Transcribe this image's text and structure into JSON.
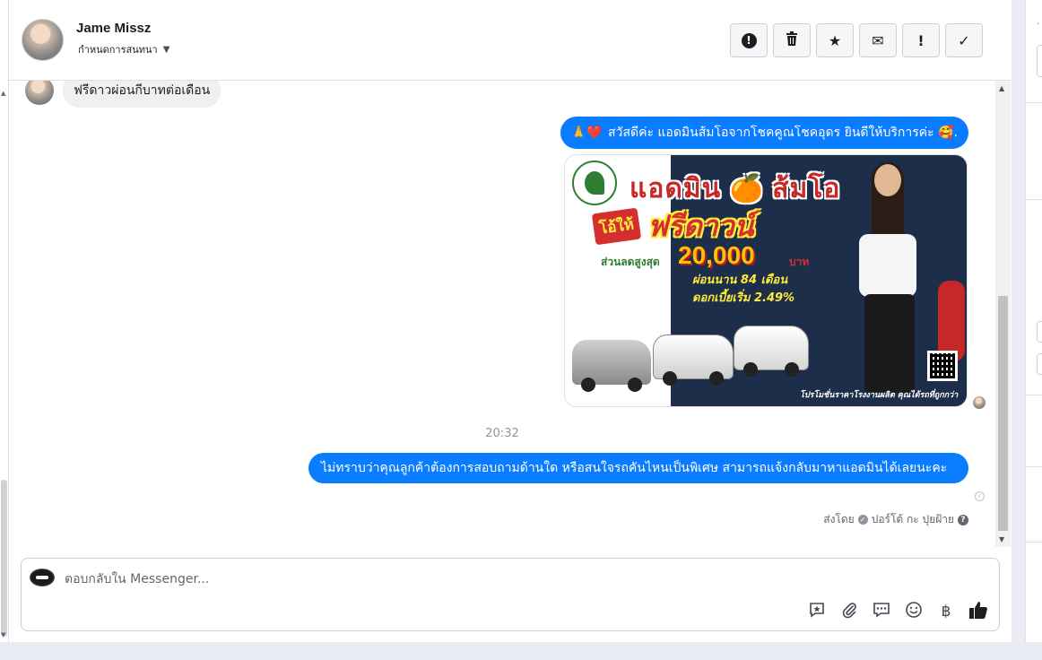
{
  "header": {
    "contact_name": "Jame Missz",
    "assign_label": "กำหนดการสนทนา",
    "toolbar": [
      {
        "name": "mark-spam-button",
        "icon": "alert-circle-icon",
        "glyph": "!"
      },
      {
        "name": "delete-button",
        "icon": "trash-icon",
        "glyph": "🗑"
      },
      {
        "name": "star-button",
        "icon": "star-icon",
        "glyph": "★"
      },
      {
        "name": "mark-unread-button",
        "icon": "envelope-icon",
        "glyph": "✉"
      },
      {
        "name": "follow-up-button",
        "icon": "exclamation-icon",
        "glyph": "!"
      },
      {
        "name": "mark-done-button",
        "icon": "check-icon",
        "glyph": "✓"
      }
    ]
  },
  "conversation": {
    "incoming_message": "ฟรีดาวผ่อนกีบาทต่อเดือน",
    "outgoing_greeting": "สวัสดีค่ะ แอดมินส้มโอจากโชคคูณโชคอุดร ยินดีให้บริการค่ะ",
    "greeting_prefix_emojis": "🙏❤️",
    "greeting_suffix": "🥰.",
    "ad_image": {
      "title": "แอดมิน 🍊 ส้มโอ",
      "give_label": "โอ้ให้",
      "headline": "ฟรีดาวน์",
      "discount_label": "ส่วนลดสูงสุด",
      "discount_amount": "20,000",
      "currency": "บาท",
      "months_text": "ผ่อนนาน 84 เดือน",
      "rate_text": "ดอกเบี้ยเริ่ม 2.49%",
      "footer": "โปรโมชั่นราคาโรงงานผลิต คุณได้รถที่ถูกกว่า"
    },
    "timestamp": "20:32",
    "outgoing_message": "ไม่ทราบว่าคุณลูกค้าต้องการสอบถามด้านใด หรือสนใจรถคันไหนเป็นพิเศษ สามารถแจ้งกลับมาหาแอดมินได้เลยนะคะ",
    "sent_by_label": "ส่งโดย",
    "sent_by_name": "ปอร์โต้ กะ ปุยฝ้าย",
    "help_glyph": "?"
  },
  "composer": {
    "placeholder": "ตอบกลับใน Messenger...",
    "tools": [
      {
        "name": "saved-reply-button",
        "icon": "saved-reply-icon",
        "glyph": "💬"
      },
      {
        "name": "attach-button",
        "icon": "paperclip-icon",
        "glyph": "📎"
      },
      {
        "name": "quick-reply-button",
        "icon": "chat-dots-icon",
        "glyph": "🗨"
      },
      {
        "name": "emoji-button",
        "icon": "smiley-icon",
        "glyph": "☺"
      },
      {
        "name": "payment-button",
        "icon": "baht-icon",
        "glyph": "฿"
      },
      {
        "name": "like-button",
        "icon": "thumbs-up-icon",
        "glyph": "👍"
      }
    ]
  },
  "colors": {
    "outgoing_bubble": "#0a7cff",
    "incoming_bubble": "#f0f0f0"
  }
}
